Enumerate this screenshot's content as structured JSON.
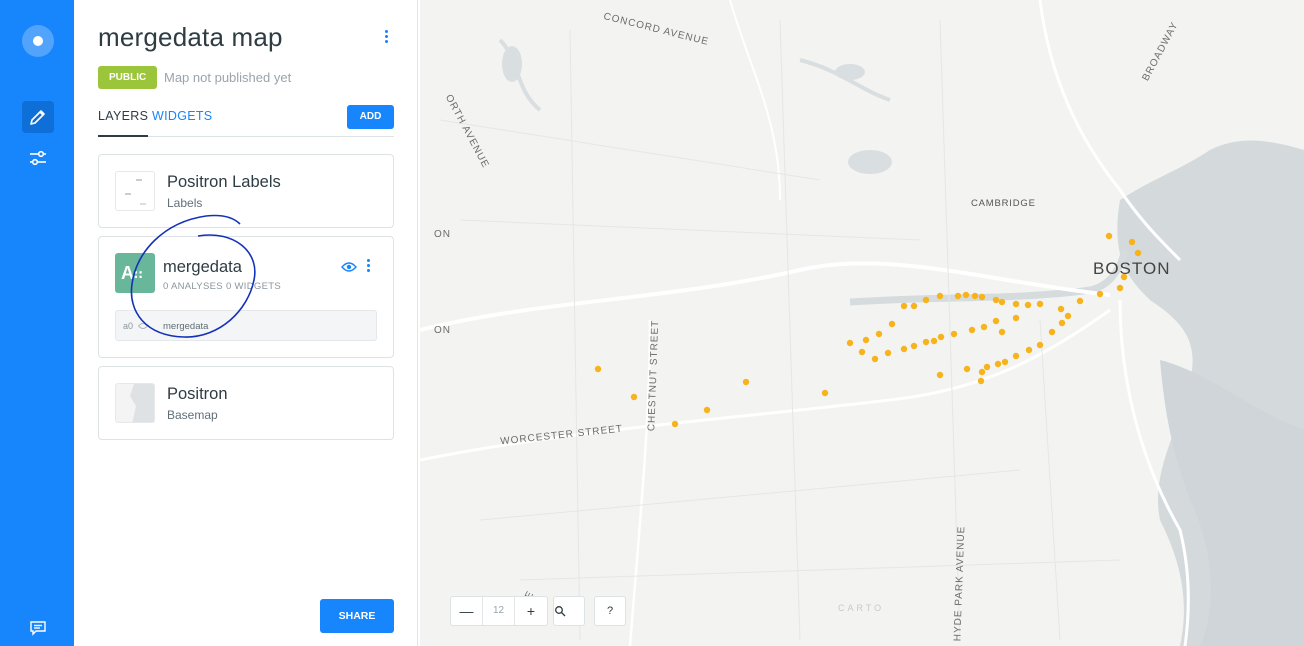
{
  "header": {
    "title": "mergedata map",
    "badge": "PUBLIC",
    "publish_status": "Map not published yet"
  },
  "tabs": [
    {
      "label": "LAYERS"
    },
    {
      "label": "WIDGETS"
    }
  ],
  "add_button": "ADD",
  "layers": [
    {
      "name": "Positron Labels",
      "subtitle": "Labels"
    },
    {
      "name": "mergedata",
      "thumb_letter": "A",
      "analyses": "0 ANALYSES",
      "widgets": "0 WIDGETS",
      "analysis_id": "a0",
      "analysis_name": "mergedata"
    },
    {
      "name": "Positron",
      "subtitle": "Basemap"
    }
  ],
  "share_button": "SHARE",
  "map": {
    "labels": {
      "concord": "CONCORD AVENUE",
      "broadway": "BROADWAY",
      "north_ave": "ORTH AVENUE",
      "cambridge": "CAMBRIDGE",
      "boston": "BOSTON",
      "chestnut": "CHESTNUT STREET",
      "worcester": "WORCESTER STREET",
      "hyde_park": "HYDE PARK AVENUE",
      "on_left_1": "ON",
      "on_left_2": "ON",
      "bottom_ave": "ENUE"
    },
    "zoom_level": "12",
    "zoom_out": "—",
    "zoom_in": "+",
    "help": "?",
    "attribution": "CARTO",
    "point_color": "#f6b31b"
  },
  "colors": {
    "accent": "#1785fb",
    "public_badge": "#9bc63b",
    "layer_thumb": "#68b79b"
  }
}
